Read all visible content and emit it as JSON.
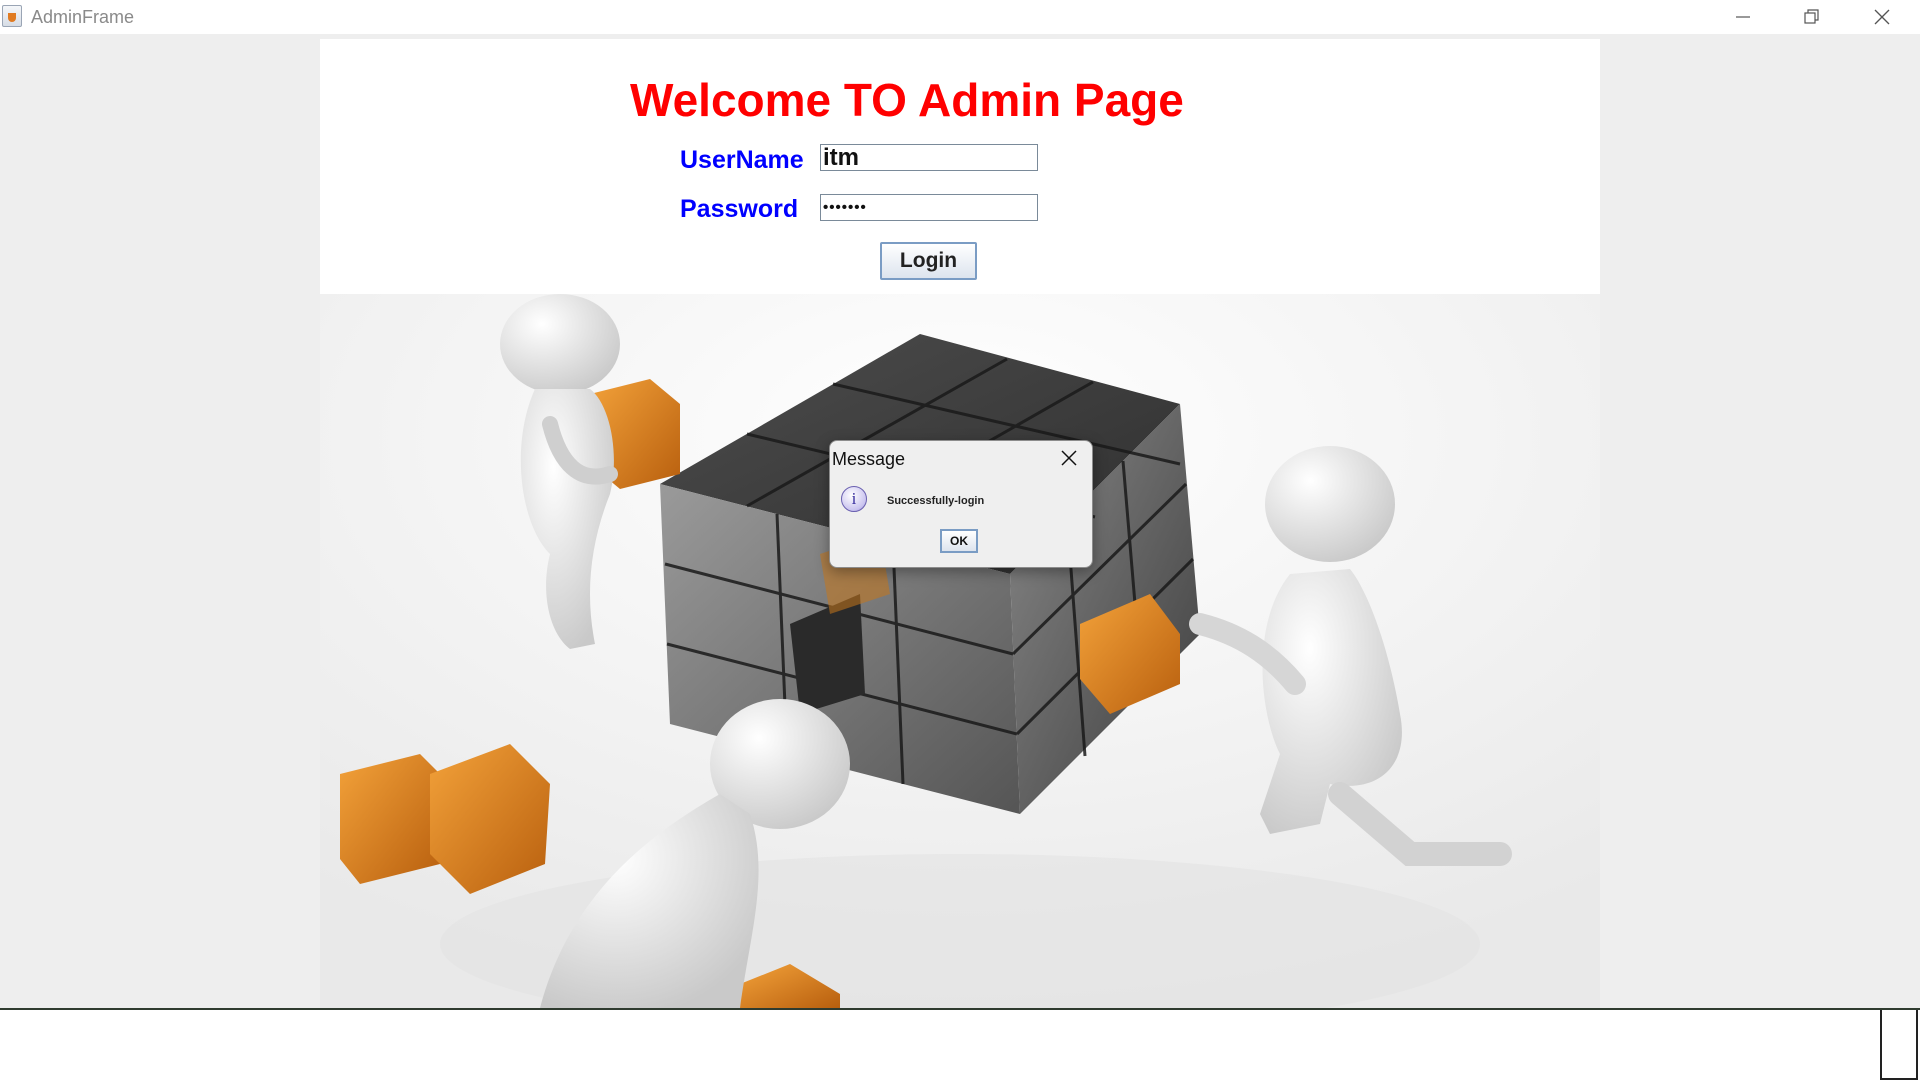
{
  "window": {
    "title": "AdminFrame"
  },
  "page": {
    "heading": "Welcome TO Admin Page",
    "username_label": "UserName",
    "username_value": "itm",
    "password_label": "Password",
    "password_value": "•••••••",
    "login_button": "Login"
  },
  "dialog": {
    "title": "Message",
    "message": "Successfully-login",
    "ok_button": "OK",
    "icon": "info-icon"
  },
  "colors": {
    "heading": "#ff0000",
    "labels": "#0000ff",
    "cube_orange": "#e0821f",
    "cube_gray": "#5a5a5a"
  }
}
